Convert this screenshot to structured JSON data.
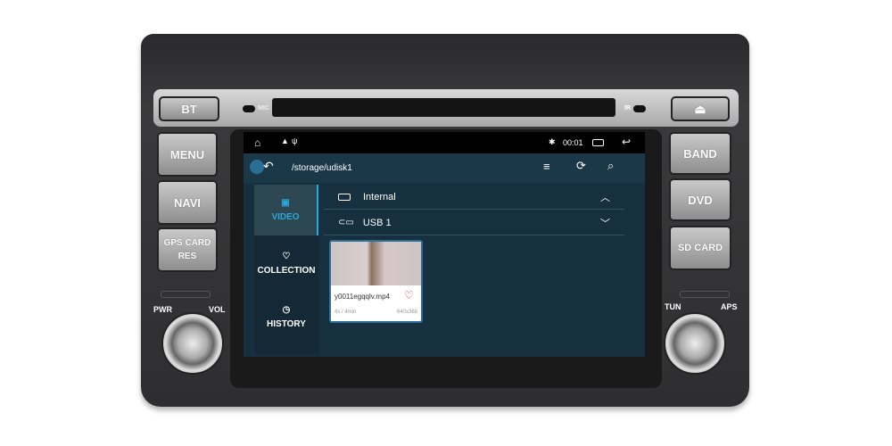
{
  "device": {
    "buttons_left": [
      "MENU",
      "NAVI",
      "GPS CARD\nRES"
    ],
    "buttons_right": [
      "BAND",
      "DVD",
      "SD CARD"
    ],
    "bt": "BT",
    "mic": "MIC",
    "ir": "IR",
    "pwr": "PWR",
    "vol": "VOL",
    "tun": "TUN",
    "aps": "APS"
  },
  "status_bar": {
    "time": "00:01",
    "icons": [
      "home-icon",
      "warning-icon",
      "usb-icon",
      "bluetooth-icon",
      "recent-apps-icon",
      "back-icon"
    ]
  },
  "toolbar": {
    "path": "/storage/udisk1",
    "icons": [
      "back-arrow-icon",
      "sort-icon",
      "refresh-icon",
      "search-icon"
    ]
  },
  "sidebar": {
    "items": [
      {
        "label": "VIDEO",
        "icon": "video-folder-icon",
        "selected": true
      },
      {
        "label": "COLLECTION",
        "icon": "heart-icon"
      },
      {
        "label": "HISTORY",
        "icon": "clock-icon"
      }
    ]
  },
  "storage": [
    {
      "label": "Internal",
      "icon": "drive-icon",
      "expanded": true
    },
    {
      "label": "USB 1",
      "icon": "usb-icon",
      "expanded": false
    }
  ],
  "files": [
    {
      "name": "y0011egqqlv.mp4",
      "duration": "4s / 4min",
      "resolution": "640x368",
      "favorite": true
    }
  ],
  "colors": {
    "accent": "#29a9d8",
    "favorite": "#e03a3a",
    "screen_bg": "#163040"
  }
}
